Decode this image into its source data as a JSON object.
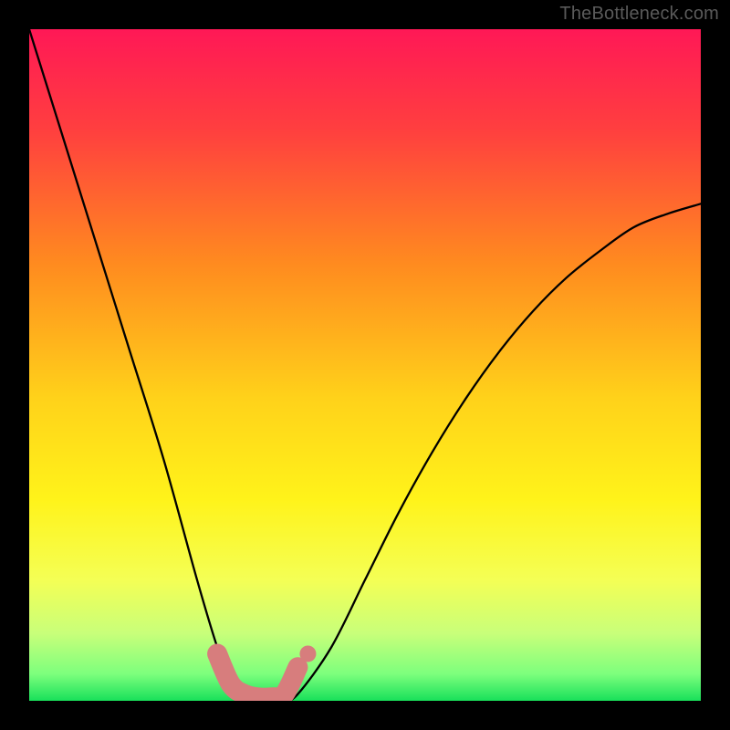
{
  "watermark": "TheBottleneck.com",
  "chart_data": {
    "type": "line",
    "title": "",
    "xlabel": "",
    "ylabel": "",
    "xlim": [
      0,
      100
    ],
    "ylim": [
      0,
      100
    ],
    "series": [
      {
        "name": "bottleneck-curve",
        "x": [
          0,
          5,
          10,
          15,
          20,
          25,
          28,
          30,
          32,
          34,
          36,
          38,
          40,
          45,
          50,
          55,
          60,
          65,
          70,
          75,
          80,
          85,
          90,
          95,
          100
        ],
        "values": [
          100,
          84,
          68,
          52,
          36,
          18,
          8,
          3,
          1,
          0,
          0,
          0,
          1,
          8,
          18,
          28,
          37,
          45,
          52,
          58,
          63,
          67,
          70.5,
          72.5,
          74
        ]
      }
    ],
    "highlight": {
      "name": "optimal-range",
      "x": [
        28,
        30,
        32,
        34,
        36,
        38,
        40
      ],
      "values": [
        7,
        2.5,
        1,
        0.5,
        0.5,
        1,
        5
      ]
    },
    "background_gradient": {
      "description": "vertical gradient from red (high bottleneck) to green (no bottleneck)",
      "stops": [
        {
          "pos": 0.0,
          "color": "#ff1856"
        },
        {
          "pos": 0.15,
          "color": "#ff3f3f"
        },
        {
          "pos": 0.35,
          "color": "#ff8b1f"
        },
        {
          "pos": 0.55,
          "color": "#ffd21a"
        },
        {
          "pos": 0.7,
          "color": "#fff31a"
        },
        {
          "pos": 0.82,
          "color": "#f4ff55"
        },
        {
          "pos": 0.9,
          "color": "#c8ff7a"
        },
        {
          "pos": 0.96,
          "color": "#7dff7d"
        },
        {
          "pos": 1.0,
          "color": "#18e05a"
        }
      ]
    }
  }
}
